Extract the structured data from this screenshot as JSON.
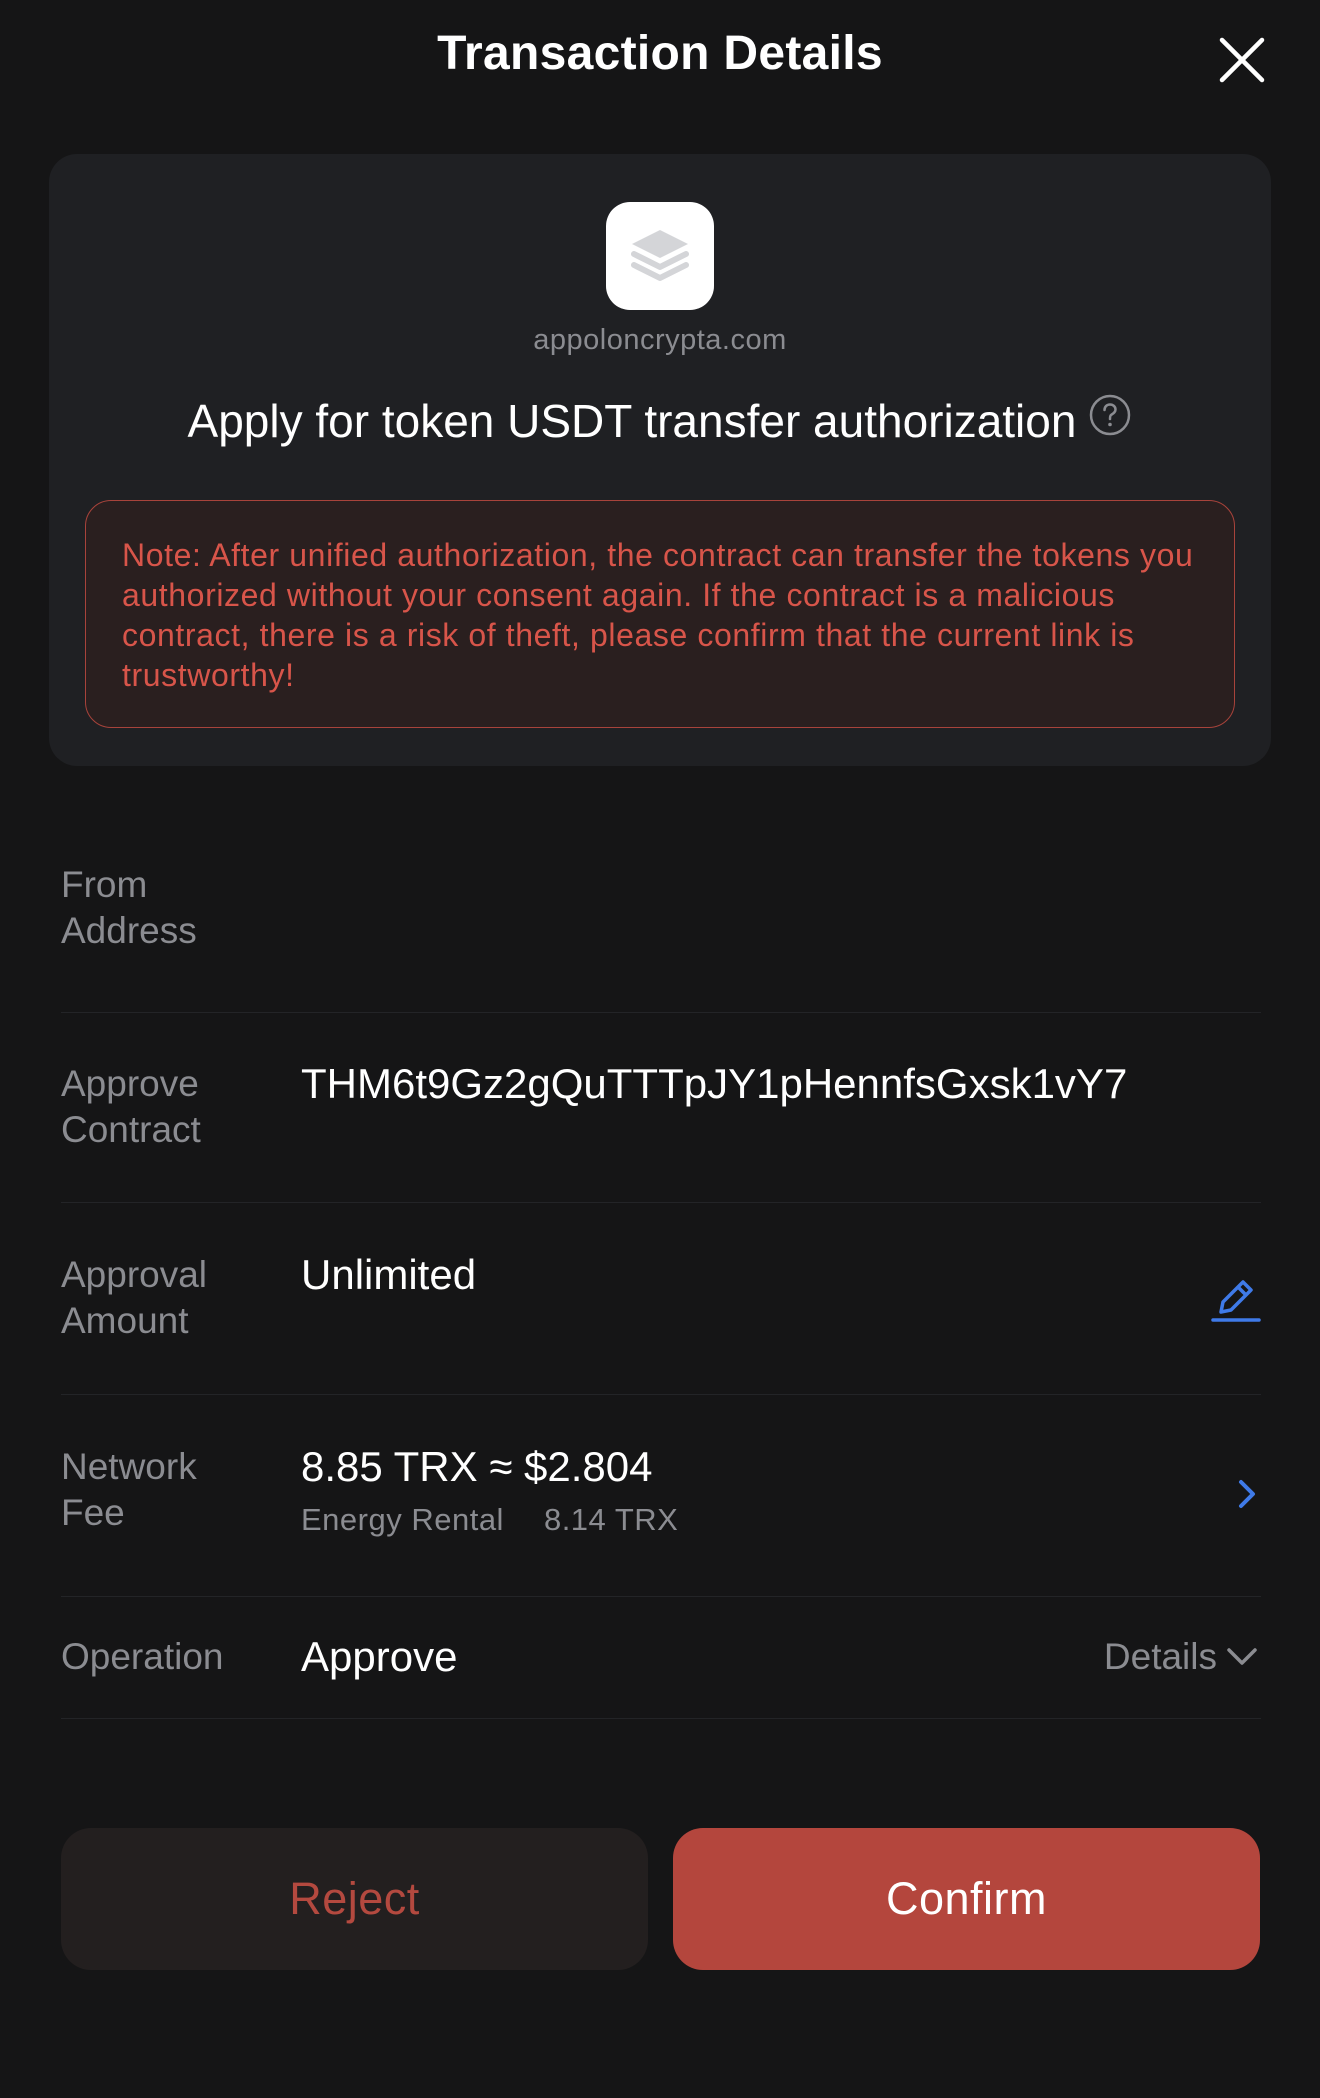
{
  "header": {
    "title": "Transaction Details"
  },
  "request": {
    "domain": "appoloncrypta.com",
    "title": "Apply for token USDT transfer authorization",
    "warning": "Note: After unified authorization, the contract can transfer the tokens you authorized without your consent again. If the contract is a malicious contract, there is a risk of theft, please confirm that the current link is trustworthy!"
  },
  "rows": {
    "from_address": {
      "label": "From Address",
      "value": ""
    },
    "approve_contract": {
      "label": "Approve Contract",
      "value": "THM6t9Gz2gQuTTTpJY1pHennfsGxsk1vY7"
    },
    "approval_amount": {
      "label": "Approval Amount",
      "value": "Unlimited"
    },
    "network_fee": {
      "label": "Network Fee",
      "value": "8.85 TRX ≈ $2.804",
      "sub_label": "Energy Rental",
      "sub_value": "8.14 TRX"
    },
    "operation": {
      "label": "Operation",
      "value": "Approve",
      "details_label": "Details"
    }
  },
  "actions": {
    "reject_label": "Reject",
    "confirm_label": "Confirm"
  },
  "colors": {
    "background": "#151516",
    "card": "#1f2023",
    "danger": "#d8554a",
    "accent_blue": "#3f7ae8",
    "confirm": "#b4463d"
  },
  "icons": {
    "close": "close-icon",
    "app": "layers-icon",
    "help": "question-circle-icon",
    "edit": "pencil-icon",
    "chevron_right": "chevron-right-icon",
    "chevron_down": "chevron-down-icon"
  }
}
